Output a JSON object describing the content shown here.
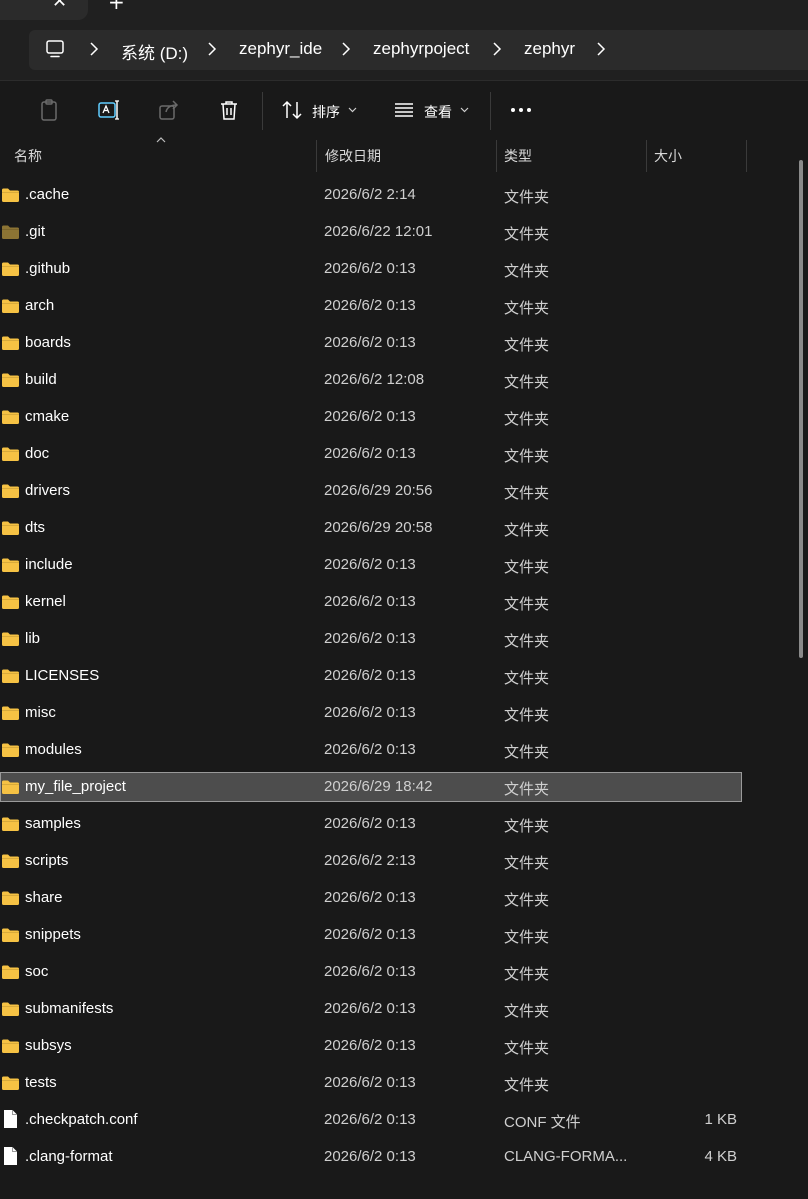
{
  "tabbar": {
    "close_glyph": "✕",
    "new_tab_glyph": "+"
  },
  "address": {
    "root_icon": "pc-icon",
    "crumbs": [
      "系统 (D:)",
      "zephyr_ide",
      "zephyrpoject",
      "zephyr"
    ]
  },
  "toolbar": {
    "paste_icon": "clipboard-icon",
    "rename_icon": "rename-icon",
    "share_icon": "share-icon",
    "delete_icon": "trash-icon",
    "sort_label": "排序",
    "view_label": "查看",
    "more_icon": "ellipsis-icon"
  },
  "columns": {
    "name": "名称",
    "date": "修改日期",
    "type": "类型",
    "size": "大小"
  },
  "colors": {
    "folder": "#f6c244",
    "folder_dim": "#8c7434",
    "selection": "#4d4d4d",
    "accent": "#60cdff"
  },
  "files": [
    {
      "name": ".cache",
      "date": "2026/6/2 2:14",
      "type": "文件夹",
      "size": "",
      "icon": "folder"
    },
    {
      "name": ".git",
      "date": "2026/6/22 12:01",
      "type": "文件夹",
      "size": "",
      "icon": "folder-hidden"
    },
    {
      "name": ".github",
      "date": "2026/6/2 0:13",
      "type": "文件夹",
      "size": "",
      "icon": "folder"
    },
    {
      "name": "arch",
      "date": "2026/6/2 0:13",
      "type": "文件夹",
      "size": "",
      "icon": "folder"
    },
    {
      "name": "boards",
      "date": "2026/6/2 0:13",
      "type": "文件夹",
      "size": "",
      "icon": "folder"
    },
    {
      "name": "build",
      "date": "2026/6/2 12:08",
      "type": "文件夹",
      "size": "",
      "icon": "folder"
    },
    {
      "name": "cmake",
      "date": "2026/6/2 0:13",
      "type": "文件夹",
      "size": "",
      "icon": "folder"
    },
    {
      "name": "doc",
      "date": "2026/6/2 0:13",
      "type": "文件夹",
      "size": "",
      "icon": "folder"
    },
    {
      "name": "drivers",
      "date": "2026/6/29 20:56",
      "type": "文件夹",
      "size": "",
      "icon": "folder"
    },
    {
      "name": "dts",
      "date": "2026/6/29 20:58",
      "type": "文件夹",
      "size": "",
      "icon": "folder"
    },
    {
      "name": "include",
      "date": "2026/6/2 0:13",
      "type": "文件夹",
      "size": "",
      "icon": "folder"
    },
    {
      "name": "kernel",
      "date": "2026/6/2 0:13",
      "type": "文件夹",
      "size": "",
      "icon": "folder"
    },
    {
      "name": "lib",
      "date": "2026/6/2 0:13",
      "type": "文件夹",
      "size": "",
      "icon": "folder"
    },
    {
      "name": "LICENSES",
      "date": "2026/6/2 0:13",
      "type": "文件夹",
      "size": "",
      "icon": "folder"
    },
    {
      "name": "misc",
      "date": "2026/6/2 0:13",
      "type": "文件夹",
      "size": "",
      "icon": "folder"
    },
    {
      "name": "modules",
      "date": "2026/6/2 0:13",
      "type": "文件夹",
      "size": "",
      "icon": "folder"
    },
    {
      "name": "my_file_project",
      "date": "2026/6/29 18:42",
      "type": "文件夹",
      "size": "",
      "icon": "folder",
      "selected": true
    },
    {
      "name": "samples",
      "date": "2026/6/2 0:13",
      "type": "文件夹",
      "size": "",
      "icon": "folder"
    },
    {
      "name": "scripts",
      "date": "2026/6/2 2:13",
      "type": "文件夹",
      "size": "",
      "icon": "folder"
    },
    {
      "name": "share",
      "date": "2026/6/2 0:13",
      "type": "文件夹",
      "size": "",
      "icon": "folder"
    },
    {
      "name": "snippets",
      "date": "2026/6/2 0:13",
      "type": "文件夹",
      "size": "",
      "icon": "folder"
    },
    {
      "name": "soc",
      "date": "2026/6/2 0:13",
      "type": "文件夹",
      "size": "",
      "icon": "folder"
    },
    {
      "name": "submanifests",
      "date": "2026/6/2 0:13",
      "type": "文件夹",
      "size": "",
      "icon": "folder"
    },
    {
      "name": "subsys",
      "date": "2026/6/2 0:13",
      "type": "文件夹",
      "size": "",
      "icon": "folder"
    },
    {
      "name": "tests",
      "date": "2026/6/2 0:13",
      "type": "文件夹",
      "size": "",
      "icon": "folder"
    },
    {
      "name": ".checkpatch.conf",
      "date": "2026/6/2 0:13",
      "type": "CONF 文件",
      "size": "1 KB",
      "icon": "file"
    },
    {
      "name": ".clang-format",
      "date": "2026/6/2 0:13",
      "type": "CLANG-FORMA...",
      "size": "4 KB",
      "icon": "file"
    }
  ]
}
